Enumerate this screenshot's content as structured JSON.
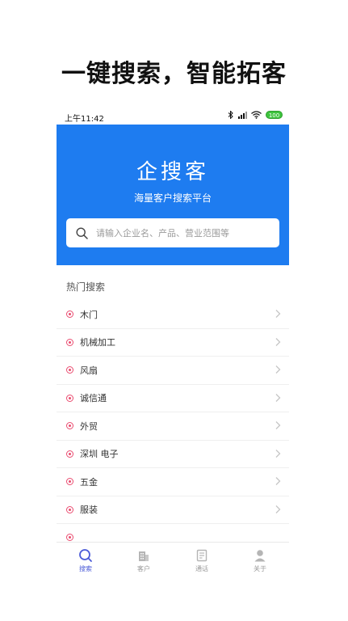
{
  "promo": {
    "headline": "一键搜索，智能拓客"
  },
  "statusbar": {
    "time": "上午11:42",
    "battery": "100"
  },
  "header": {
    "app_title": "企搜客",
    "subtitle": "海量客户搜索平台"
  },
  "search": {
    "placeholder": "请输入企业名、产品、营业范围等",
    "value": ""
  },
  "hot": {
    "title": "热门搜索",
    "items": [
      {
        "label": "木门"
      },
      {
        "label": "机械加工"
      },
      {
        "label": "风扇"
      },
      {
        "label": "诚信通"
      },
      {
        "label": "外贸"
      },
      {
        "label": "深圳 电子"
      },
      {
        "label": "五金"
      },
      {
        "label": "服装"
      }
    ]
  },
  "tabs": [
    {
      "label": "搜索",
      "icon": "search-icon",
      "active": true
    },
    {
      "label": "客户",
      "icon": "building-icon"
    },
    {
      "label": "通话",
      "icon": "call-log-icon"
    },
    {
      "label": "关于",
      "icon": "person-icon"
    }
  ],
  "colors": {
    "brand": "#1e7cf0",
    "accent_dot": "#ea4c70",
    "tab_active": "#4b5bd8"
  }
}
